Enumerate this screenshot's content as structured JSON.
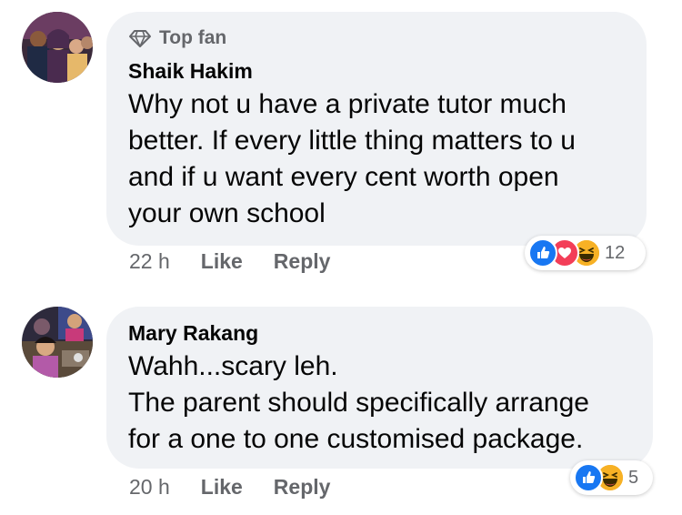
{
  "comments": [
    {
      "badge": "Top fan",
      "author": "Shaik Hakim",
      "text": "Why not u have a private tutor much\nbetter. If every little thing matters to u\nand if u want every cent worth open\nyour own school",
      "time": "22 h",
      "like_label": "Like",
      "reply_label": "Reply",
      "reaction_count": "12",
      "reactions": [
        "like",
        "love",
        "haha"
      ]
    },
    {
      "author": "Mary Rakang",
      "text": "Wahh...scary leh.\nThe parent should specifically arrange\nfor a one to one customised package.",
      "time": "20 h",
      "like_label": "Like",
      "reply_label": "Reply",
      "reaction_count": "5",
      "reactions": [
        "like",
        "haha"
      ]
    }
  ],
  "colors": {
    "bubble": "#f0f2f5",
    "meta_text": "#65676b",
    "like_blue": "#1877f2",
    "love_red": "#f33e58",
    "haha_yellow": "#f7b125"
  }
}
